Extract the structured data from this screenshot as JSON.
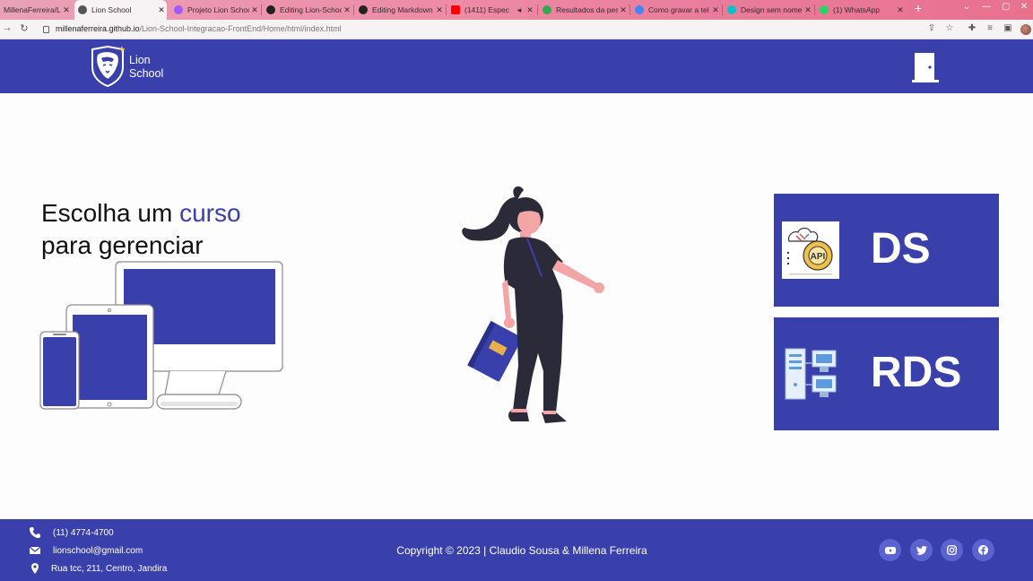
{
  "browser": {
    "tabs": [
      {
        "label": "MillenaFerreira/Lio",
        "color": "#555555",
        "active": false
      },
      {
        "label": "Lion School",
        "color": "#444444",
        "active": true
      },
      {
        "label": "Projeto Lion School",
        "color": "#a259ff",
        "active": false
      },
      {
        "label": "Editing Lion-Schoo",
        "color": "#222222",
        "active": false
      },
      {
        "label": "Editing Markdown",
        "color": "#222222",
        "active": false
      },
      {
        "label": "(1411) Espec",
        "color": "#ff0000",
        "active": false
      },
      {
        "label": "Resultados da pes",
        "color": "#34a853",
        "active": false
      },
      {
        "label": "Como gravar a tel",
        "color": "#4285f4",
        "active": false
      },
      {
        "label": "Design sem nome",
        "color": "#00c4cc",
        "active": false
      },
      {
        "label": "(1) WhatsApp",
        "color": "#25d366",
        "active": false
      }
    ],
    "new_tab_label": "+",
    "url_host": "millenaferreira.github.io",
    "url_path": "/Lion-School-Integracao-FrontEnd/Home/html/index.html"
  },
  "header": {
    "brand_line1": "Lion",
    "brand_line2": "School",
    "logo_icon": "lion-shield-logo",
    "exit_icon": "door-icon"
  },
  "main": {
    "headline_part1": "Escolha um ",
    "headline_accent": "curso",
    "headline_line2": "para gerenciar",
    "courses": [
      {
        "title": "DS",
        "icon": "api-gear-icon"
      },
      {
        "title": "RDS",
        "icon": "server-network-icon"
      }
    ]
  },
  "footer": {
    "phone": "(11) 4774-4700",
    "email": "lionschool@gmail.com",
    "address": "Rua tcc, 211, Centro, Jandira",
    "copyright": "Copyright © 2023 | Claudio Sousa & Millena Ferreira",
    "socials": [
      "youtube",
      "twitter",
      "instagram",
      "facebook"
    ]
  },
  "colors": {
    "primary": "#3a40ab",
    "accent_text": "#3a40ab",
    "tab_strip": "#e97c9b"
  }
}
